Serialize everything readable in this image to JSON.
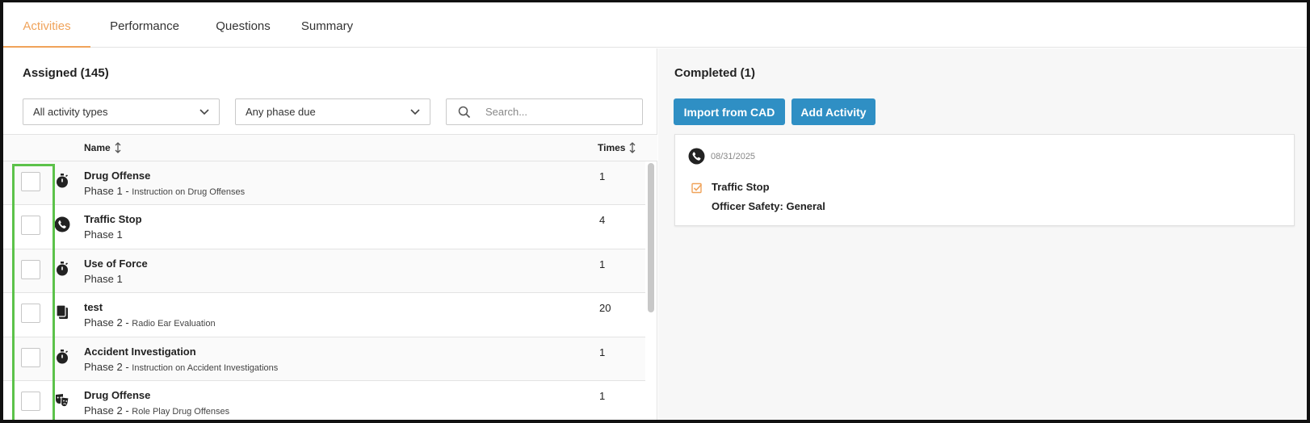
{
  "tabs": [
    {
      "label": "Activities",
      "active": true
    },
    {
      "label": "Performance",
      "active": false
    },
    {
      "label": "Questions",
      "active": false
    },
    {
      "label": "Summary",
      "active": false
    }
  ],
  "assigned": {
    "title": "Assigned (145)",
    "filter_type": "All activity types",
    "filter_phase": "Any phase due",
    "search_placeholder": "Search...",
    "columns": {
      "name": "Name",
      "times": "Times"
    },
    "rows": [
      {
        "name": "Drug Offense",
        "phase": "Phase 1",
        "desc": "Instruction on Drug Offenses",
        "times": "1",
        "icon": "stopwatch-icon"
      },
      {
        "name": "Traffic Stop",
        "phase": "Phase 1",
        "desc": "",
        "times": "4",
        "icon": "phone-icon"
      },
      {
        "name": "Use of Force",
        "phase": "Phase 1",
        "desc": "",
        "times": "1",
        "icon": "stopwatch-icon"
      },
      {
        "name": "test",
        "phase": "Phase 2",
        "desc": "Radio Ear Evaluation",
        "times": "20",
        "icon": "documents-icon"
      },
      {
        "name": "Accident Investigation",
        "phase": "Phase 2",
        "desc": "Instruction on Accident Investigations",
        "times": "1",
        "icon": "stopwatch-icon"
      },
      {
        "name": "Drug Offense",
        "phase": "Phase 2",
        "desc": "Role Play Drug Offenses",
        "times": "1",
        "icon": "theater-masks-icon"
      }
    ]
  },
  "completed": {
    "title": "Completed (1)",
    "import_button": "Import from CAD",
    "add_button": "Add Activity",
    "card": {
      "date": "08/31/2025",
      "title": "Traffic Stop",
      "subtitle": "Officer Safety: General"
    }
  },
  "colors": {
    "accent": "#f0a35a",
    "button": "#2f8fc4",
    "highlight": "#5cc24a"
  }
}
